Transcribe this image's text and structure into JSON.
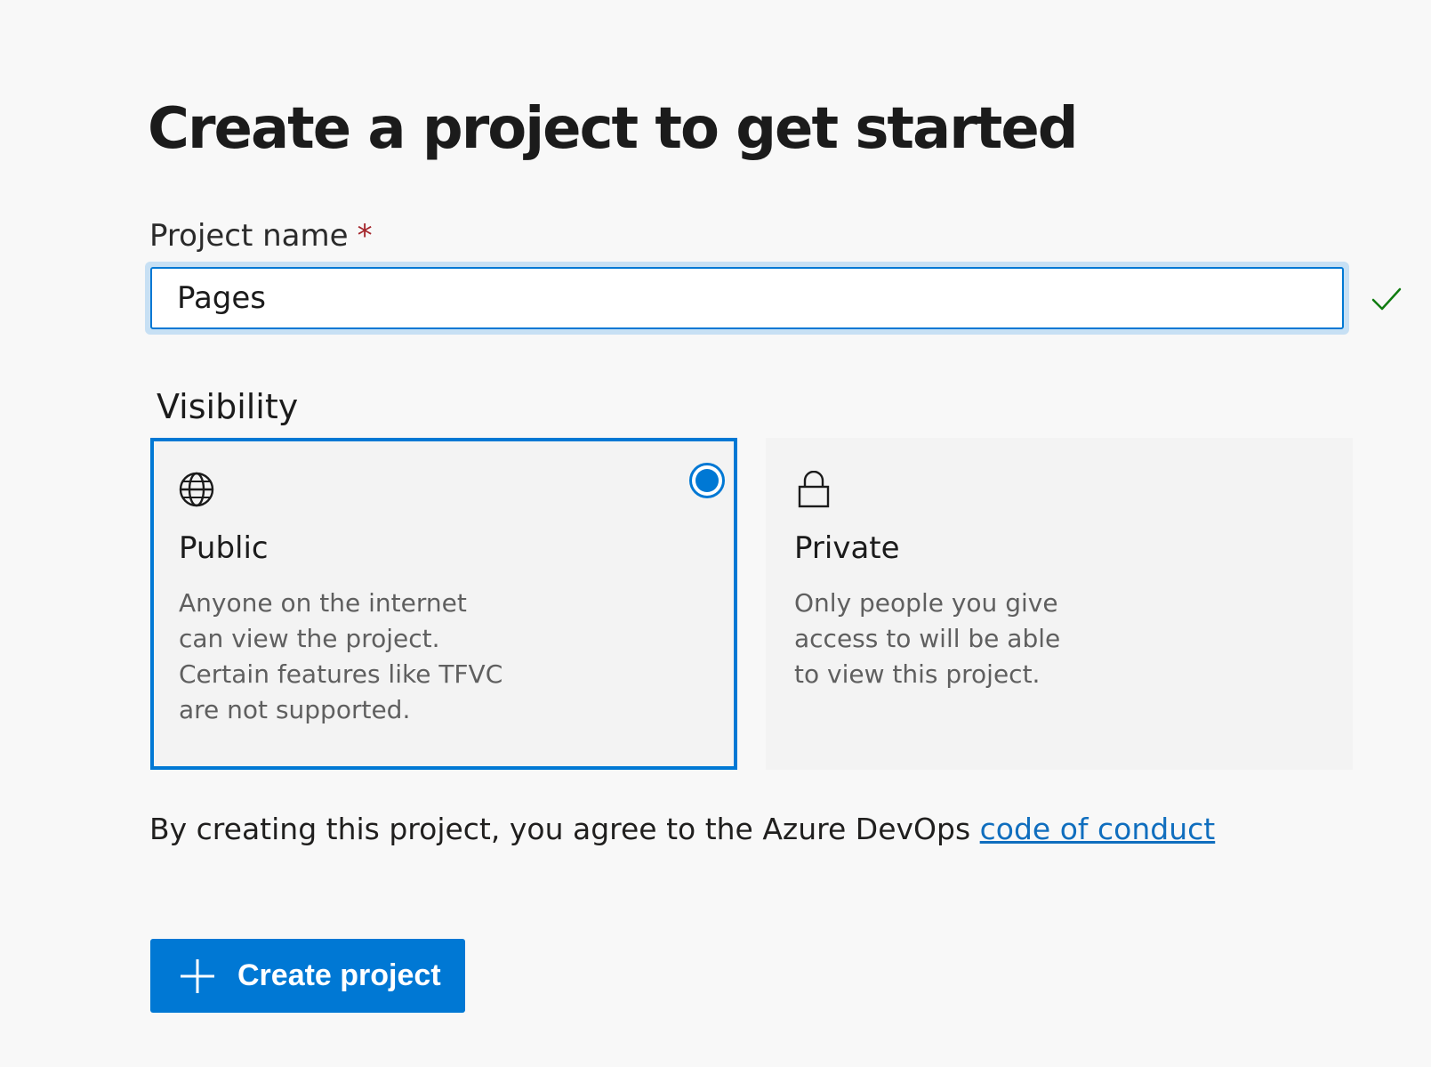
{
  "page": {
    "title": "Create a project to get started"
  },
  "project_name": {
    "label": "Project name",
    "required_marker": "*",
    "value": "Pages",
    "status_icon": "checkmark-icon"
  },
  "visibility": {
    "label": "Visibility",
    "options": [
      {
        "title": "Public",
        "description": "Anyone on the internet can view the project. Certain features like TFVC are not supported.",
        "icon": "globe-icon",
        "selected": true
      },
      {
        "title": "Private",
        "description": "Only people you give access to will be able to view this project.",
        "icon": "lock-icon",
        "selected": false
      }
    ]
  },
  "agreement": {
    "text": "By creating this project, you agree to the Azure DevOps",
    "link_text": "code of conduct"
  },
  "create_button": {
    "label": "Create project",
    "icon": "plus-icon"
  },
  "colors": {
    "accent": "#0078d4",
    "link": "#106ebe",
    "success": "#107c10",
    "required": "#a4262c",
    "background": "#f8f8f8",
    "card_background": "#f3f3f3"
  }
}
